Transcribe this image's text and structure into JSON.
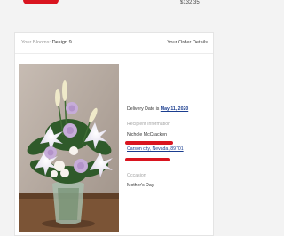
{
  "top": {
    "price": "$132.35"
  },
  "header": {
    "blooms_label": "Your Blooms:",
    "design_name": "Design 9",
    "order_details_link": "Your Order Details"
  },
  "delivery": {
    "label": "Delivery Date is",
    "date": "May 11, 2020"
  },
  "recipient": {
    "section_label": "Recipient Information",
    "name": "Nichole McCracken",
    "city_state_zip": "Carson city, Nevada, 89701"
  },
  "occasion": {
    "section_label": "Occasion",
    "value": "Mother's Day"
  },
  "colors": {
    "redaction": "#d9141f",
    "link": "#1a3d8f"
  }
}
